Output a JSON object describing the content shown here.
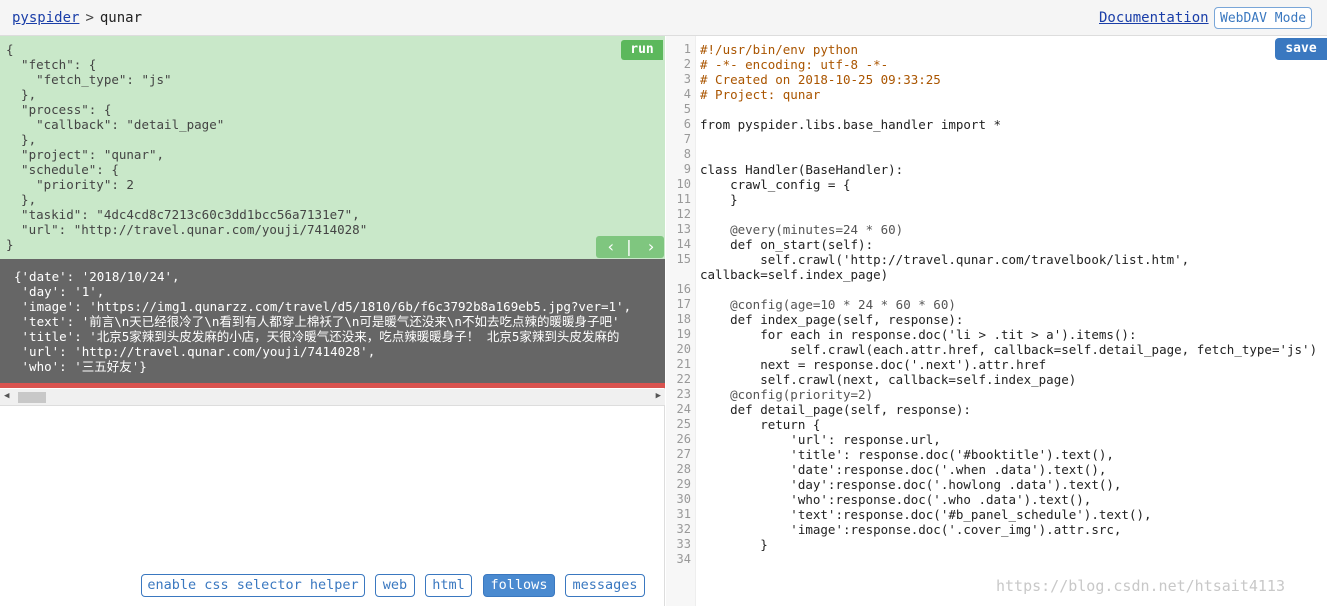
{
  "header": {
    "root_link": "pyspider",
    "separator": ">",
    "project_name": "qunar",
    "documentation_link": "Documentation",
    "webdav_button": "WebDAV Mode"
  },
  "task_panel": {
    "run_label": "run",
    "prev_icon": "chevron-left-icon",
    "next_icon": "chevron-right-icon",
    "json_lines": [
      "{",
      "  \"fetch\": {",
      "    \"fetch_type\": \"js\"",
      "  },",
      "  \"process\": {",
      "    \"callback\": \"detail_page\"",
      "  },",
      "  \"project\": \"qunar\",",
      "  \"schedule\": {",
      "    \"priority\": 2",
      "  },",
      "  \"taskid\": \"4dc4cd8c7213c60c3dd1bcc56a7131e7\",",
      "  \"url\": \"http://travel.qunar.com/youji/7414028\"",
      "}"
    ]
  },
  "result_panel": {
    "lines": [
      "{'date': '2018/10/24',",
      " 'day': '1',",
      " 'image': 'https://img1.qunarzz.com/travel/d5/1810/6b/f6c3792b8a169eb5.jpg?ver=1',",
      " 'text': '前言\\n天已经很冷了\\n看到有人都穿上棉袄了\\n可是暖气还没来\\n不如去吃点辣的暖暖身子吧'",
      " 'title': '北京5家辣到头皮发麻的小店，天很冷暖气还没来，吃点辣暖暖身子！ 北京5家辣到头皮发麻的",
      " 'url': 'http://travel.qunar.com/youji/7414028',",
      " 'who': '三五好友'}"
    ]
  },
  "bottom_tabs": [
    {
      "label": "enable css selector helper",
      "active": false
    },
    {
      "label": "web",
      "active": false
    },
    {
      "label": "html",
      "active": false
    },
    {
      "label": "follows",
      "active": true
    },
    {
      "label": "messages",
      "active": false
    }
  ],
  "editor": {
    "save_label": "save",
    "line_numbers": [
      "1",
      "2",
      "3",
      "4",
      "5",
      "6",
      "7",
      "8",
      "9",
      "10",
      "11",
      "12",
      "13",
      "14",
      "15",
      "",
      "16",
      "17",
      "18",
      "19",
      "20",
      "21",
      "22",
      "23",
      "24",
      "25",
      "26",
      "27",
      "28",
      "29",
      "30",
      "31",
      "32",
      "33",
      "34"
    ],
    "code_lines": [
      "#!/usr/bin/env python",
      "# -*- encoding: utf-8 -*-",
      "# Created on 2018-10-25 09:33:25",
      "# Project: qunar",
      "",
      "from pyspider.libs.base_handler import *",
      "",
      "",
      "class Handler(BaseHandler):",
      "    crawl_config = {",
      "    }",
      "",
      "    @every(minutes=24 * 60)",
      "    def on_start(self):",
      "        self.crawl('http://travel.qunar.com/travelbook/list.htm',",
      "callback=self.index_page)",
      "",
      "    @config(age=10 * 24 * 60 * 60)",
      "    def index_page(self, response):",
      "        for each in response.doc('li > .tit > a').items():",
      "            self.crawl(each.attr.href, callback=self.detail_page, fetch_type='js')",
      "        next = response.doc('.next').attr.href",
      "        self.crawl(next, callback=self.index_page)",
      "    @config(priority=2)",
      "    def detail_page(self, response):",
      "        return {",
      "            'url': response.url,",
      "            'title': response.doc('#booktitle').text(),",
      "            'date':response.doc('.when .data').text(),",
      "            'day':response.doc('.howlong .data').text(),",
      "            'who':response.doc('.who .data').text(),",
      "            'text':response.doc('#b_panel_schedule').text(),",
      "            'image':response.doc('.cover_img').attr.src,",
      "        }",
      ""
    ]
  },
  "watermark": "https://blog.csdn.net/htsait4113"
}
